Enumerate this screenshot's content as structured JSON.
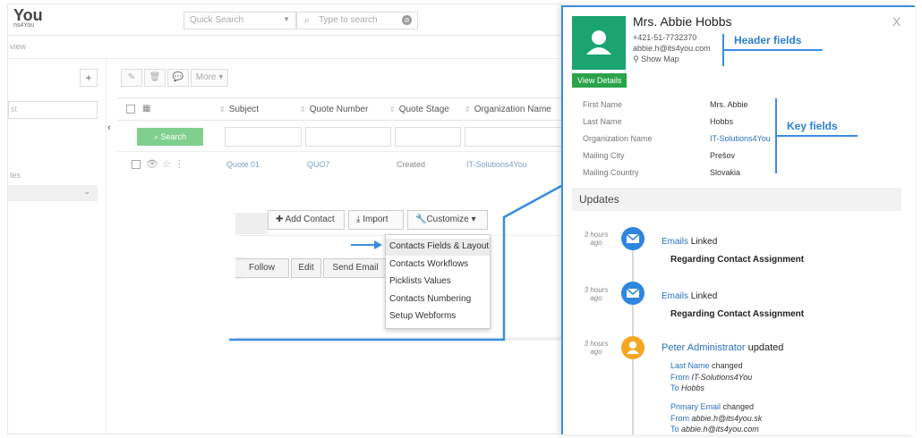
{
  "app": {
    "logo_text": "You",
    "logo_sub": "ns4You",
    "quick_search": "Quick Search",
    "type_search": "Type to search",
    "breadcrumb": "view",
    "left_input": "st",
    "left_label": "tes",
    "toolbar_more": "More",
    "columns": [
      "Subject",
      "Quote Number",
      "Quote Stage",
      "Organization Name"
    ],
    "search_button": "Search",
    "row": {
      "subject": "Quote 01",
      "number": "QUO7",
      "stage": "Created",
      "organization": "IT-Solutions4You"
    },
    "buttons": {
      "add_contact": "Add Contact",
      "import": "Import",
      "customize": "Customize"
    },
    "lower_buttons": [
      "Follow",
      "Edit",
      "Send Email"
    ],
    "dropdown": [
      "Contacts Fields & Layout",
      "Contacts Workflows",
      "Picklists Values",
      "Contacts Numbering",
      "Setup Webforms"
    ]
  },
  "annotations": {
    "header_fields": "Header fields",
    "key_fields": "Key fields"
  },
  "panel": {
    "name": "Mrs. Abbie Hobbs",
    "phone": "+421-51-7732370",
    "email": "abbie.h@its4you.com",
    "show_map": "Show Map",
    "view_details": "View Details",
    "close": "X",
    "fields": [
      {
        "label": "First Name",
        "value": "Mrs. Abbie"
      },
      {
        "label": "Last Name",
        "value": "Hobbs"
      },
      {
        "label": "Organization Name",
        "value": "IT-Solutions4You"
      },
      {
        "label": "Mailing City",
        "value": "Prešov"
      },
      {
        "label": "Mailing Country",
        "value": "Slovakia"
      }
    ],
    "updates_title": "Updates",
    "updates": [
      {
        "ago": "3 hours ago",
        "link": "Emails",
        "action": "Linked",
        "detail": "Regarding Contact Assignment"
      },
      {
        "ago": "3 hours ago",
        "link": "Emails",
        "action": "Linked",
        "detail": "Regarding Contact Assignment"
      },
      {
        "ago": "3 hours ago",
        "link": "Peter Administrator",
        "action": "updated",
        "changes": [
          {
            "field": "Last Name",
            "changed": "changed",
            "from_label": "From",
            "from": "IT-Solutions4You",
            "to_label": "To",
            "to": "Hobbs"
          },
          {
            "field": "Primary Email",
            "changed": "changed",
            "from_label": "From",
            "from": "abbie.h@its4you.sk",
            "to_label": "To",
            "to": "abbie.h@its4you.com"
          }
        ]
      }
    ]
  },
  "colors": {
    "accent_blue": "#3a8de0",
    "avatar_green": "#19a470",
    "view_details_green": "#2aa34a",
    "email_icon": "#2e86de",
    "user_icon": "#f5a623"
  }
}
